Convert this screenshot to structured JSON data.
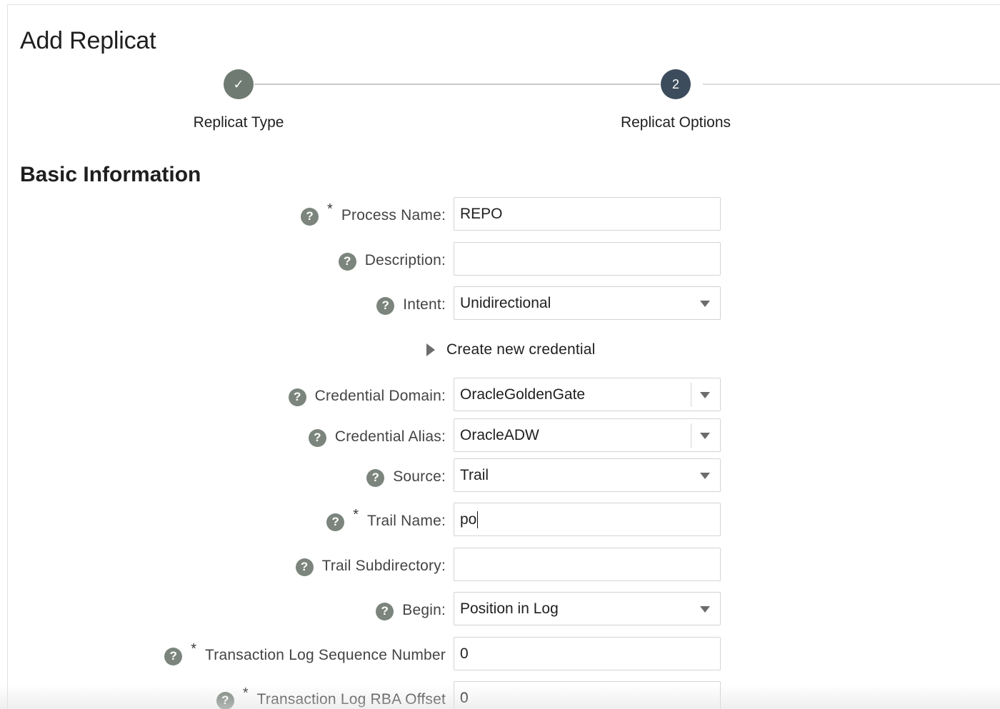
{
  "page": {
    "title": "Add Replicat"
  },
  "train": {
    "steps": [
      {
        "label": "Replicat Type",
        "status": "completed",
        "icon": "check-icon",
        "marker": "✓"
      },
      {
        "label": "Replicat Options",
        "status": "current",
        "marker": "2"
      }
    ]
  },
  "section": {
    "title": "Basic Information"
  },
  "form": {
    "process_name": {
      "label": "Process Name:",
      "required": "*",
      "value": "REPO"
    },
    "description": {
      "label": "Description:",
      "value": ""
    },
    "intent": {
      "label": "Intent:",
      "value": "Unidirectional"
    },
    "create_credential": {
      "label": "Create new credential"
    },
    "credential_domain": {
      "label": "Credential Domain:",
      "value": "OracleGoldenGate"
    },
    "credential_alias": {
      "label": "Credential Alias:",
      "value": "OracleADW"
    },
    "source": {
      "label": "Source:",
      "value": "Trail"
    },
    "trail_name": {
      "label": "Trail Name:",
      "required": "*",
      "value": "po"
    },
    "trail_subdirectory": {
      "label": "Trail Subdirectory:",
      "value": ""
    },
    "begin": {
      "label": "Begin:",
      "value": "Position in Log"
    },
    "log_sequence_number": {
      "label": "Transaction Log Sequence Number",
      "required": "*",
      "value": "0"
    },
    "log_rba_offset": {
      "label": "Transaction Log RBA Offset",
      "required": "*",
      "value": "0"
    }
  },
  "icons": {
    "help": "help-icon",
    "help_glyph": "?",
    "dropdown": "chevron-down-icon",
    "disclosure": "triangle-right-icon"
  },
  "colors": {
    "completed_step": "#6f7a72",
    "current_step": "#3c4c5c",
    "help_icon": "#7b857d"
  }
}
